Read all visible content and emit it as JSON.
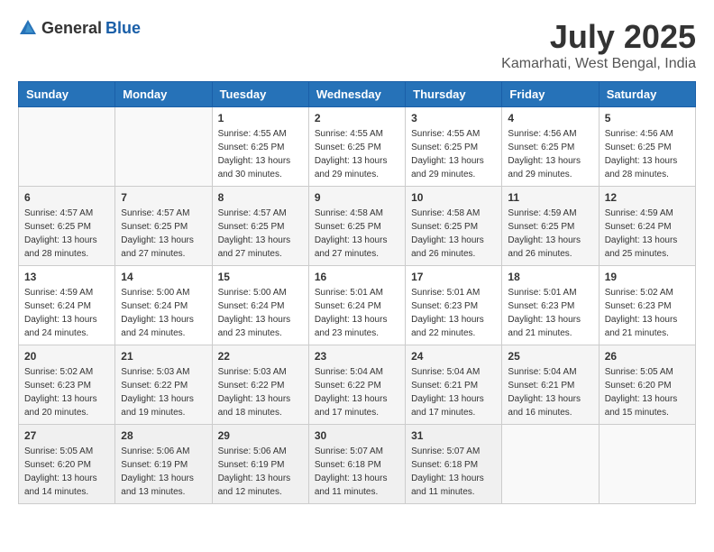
{
  "logo": {
    "general": "General",
    "blue": "Blue"
  },
  "title": "July 2025",
  "location": "Kamarhati, West Bengal, India",
  "days_of_week": [
    "Sunday",
    "Monday",
    "Tuesday",
    "Wednesday",
    "Thursday",
    "Friday",
    "Saturday"
  ],
  "weeks": [
    [
      {
        "day": "",
        "sunrise": "",
        "sunset": "",
        "daylight": ""
      },
      {
        "day": "",
        "sunrise": "",
        "sunset": "",
        "daylight": ""
      },
      {
        "day": "1",
        "sunrise": "Sunrise: 4:55 AM",
        "sunset": "Sunset: 6:25 PM",
        "daylight": "Daylight: 13 hours and 30 minutes."
      },
      {
        "day": "2",
        "sunrise": "Sunrise: 4:55 AM",
        "sunset": "Sunset: 6:25 PM",
        "daylight": "Daylight: 13 hours and 29 minutes."
      },
      {
        "day": "3",
        "sunrise": "Sunrise: 4:55 AM",
        "sunset": "Sunset: 6:25 PM",
        "daylight": "Daylight: 13 hours and 29 minutes."
      },
      {
        "day": "4",
        "sunrise": "Sunrise: 4:56 AM",
        "sunset": "Sunset: 6:25 PM",
        "daylight": "Daylight: 13 hours and 29 minutes."
      },
      {
        "day": "5",
        "sunrise": "Sunrise: 4:56 AM",
        "sunset": "Sunset: 6:25 PM",
        "daylight": "Daylight: 13 hours and 28 minutes."
      }
    ],
    [
      {
        "day": "6",
        "sunrise": "Sunrise: 4:57 AM",
        "sunset": "Sunset: 6:25 PM",
        "daylight": "Daylight: 13 hours and 28 minutes."
      },
      {
        "day": "7",
        "sunrise": "Sunrise: 4:57 AM",
        "sunset": "Sunset: 6:25 PM",
        "daylight": "Daylight: 13 hours and 27 minutes."
      },
      {
        "day": "8",
        "sunrise": "Sunrise: 4:57 AM",
        "sunset": "Sunset: 6:25 PM",
        "daylight": "Daylight: 13 hours and 27 minutes."
      },
      {
        "day": "9",
        "sunrise": "Sunrise: 4:58 AM",
        "sunset": "Sunset: 6:25 PM",
        "daylight": "Daylight: 13 hours and 27 minutes."
      },
      {
        "day": "10",
        "sunrise": "Sunrise: 4:58 AM",
        "sunset": "Sunset: 6:25 PM",
        "daylight": "Daylight: 13 hours and 26 minutes."
      },
      {
        "day": "11",
        "sunrise": "Sunrise: 4:59 AM",
        "sunset": "Sunset: 6:25 PM",
        "daylight": "Daylight: 13 hours and 26 minutes."
      },
      {
        "day": "12",
        "sunrise": "Sunrise: 4:59 AM",
        "sunset": "Sunset: 6:24 PM",
        "daylight": "Daylight: 13 hours and 25 minutes."
      }
    ],
    [
      {
        "day": "13",
        "sunrise": "Sunrise: 4:59 AM",
        "sunset": "Sunset: 6:24 PM",
        "daylight": "Daylight: 13 hours and 24 minutes."
      },
      {
        "day": "14",
        "sunrise": "Sunrise: 5:00 AM",
        "sunset": "Sunset: 6:24 PM",
        "daylight": "Daylight: 13 hours and 24 minutes."
      },
      {
        "day": "15",
        "sunrise": "Sunrise: 5:00 AM",
        "sunset": "Sunset: 6:24 PM",
        "daylight": "Daylight: 13 hours and 23 minutes."
      },
      {
        "day": "16",
        "sunrise": "Sunrise: 5:01 AM",
        "sunset": "Sunset: 6:24 PM",
        "daylight": "Daylight: 13 hours and 23 minutes."
      },
      {
        "day": "17",
        "sunrise": "Sunrise: 5:01 AM",
        "sunset": "Sunset: 6:23 PM",
        "daylight": "Daylight: 13 hours and 22 minutes."
      },
      {
        "day": "18",
        "sunrise": "Sunrise: 5:01 AM",
        "sunset": "Sunset: 6:23 PM",
        "daylight": "Daylight: 13 hours and 21 minutes."
      },
      {
        "day": "19",
        "sunrise": "Sunrise: 5:02 AM",
        "sunset": "Sunset: 6:23 PM",
        "daylight": "Daylight: 13 hours and 21 minutes."
      }
    ],
    [
      {
        "day": "20",
        "sunrise": "Sunrise: 5:02 AM",
        "sunset": "Sunset: 6:23 PM",
        "daylight": "Daylight: 13 hours and 20 minutes."
      },
      {
        "day": "21",
        "sunrise": "Sunrise: 5:03 AM",
        "sunset": "Sunset: 6:22 PM",
        "daylight": "Daylight: 13 hours and 19 minutes."
      },
      {
        "day": "22",
        "sunrise": "Sunrise: 5:03 AM",
        "sunset": "Sunset: 6:22 PM",
        "daylight": "Daylight: 13 hours and 18 minutes."
      },
      {
        "day": "23",
        "sunrise": "Sunrise: 5:04 AM",
        "sunset": "Sunset: 6:22 PM",
        "daylight": "Daylight: 13 hours and 17 minutes."
      },
      {
        "day": "24",
        "sunrise": "Sunrise: 5:04 AM",
        "sunset": "Sunset: 6:21 PM",
        "daylight": "Daylight: 13 hours and 17 minutes."
      },
      {
        "day": "25",
        "sunrise": "Sunrise: 5:04 AM",
        "sunset": "Sunset: 6:21 PM",
        "daylight": "Daylight: 13 hours and 16 minutes."
      },
      {
        "day": "26",
        "sunrise": "Sunrise: 5:05 AM",
        "sunset": "Sunset: 6:20 PM",
        "daylight": "Daylight: 13 hours and 15 minutes."
      }
    ],
    [
      {
        "day": "27",
        "sunrise": "Sunrise: 5:05 AM",
        "sunset": "Sunset: 6:20 PM",
        "daylight": "Daylight: 13 hours and 14 minutes."
      },
      {
        "day": "28",
        "sunrise": "Sunrise: 5:06 AM",
        "sunset": "Sunset: 6:19 PM",
        "daylight": "Daylight: 13 hours and 13 minutes."
      },
      {
        "day": "29",
        "sunrise": "Sunrise: 5:06 AM",
        "sunset": "Sunset: 6:19 PM",
        "daylight": "Daylight: 13 hours and 12 minutes."
      },
      {
        "day": "30",
        "sunrise": "Sunrise: 5:07 AM",
        "sunset": "Sunset: 6:18 PM",
        "daylight": "Daylight: 13 hours and 11 minutes."
      },
      {
        "day": "31",
        "sunrise": "Sunrise: 5:07 AM",
        "sunset": "Sunset: 6:18 PM",
        "daylight": "Daylight: 13 hours and 11 minutes."
      },
      {
        "day": "",
        "sunrise": "",
        "sunset": "",
        "daylight": ""
      },
      {
        "day": "",
        "sunrise": "",
        "sunset": "",
        "daylight": ""
      }
    ]
  ]
}
